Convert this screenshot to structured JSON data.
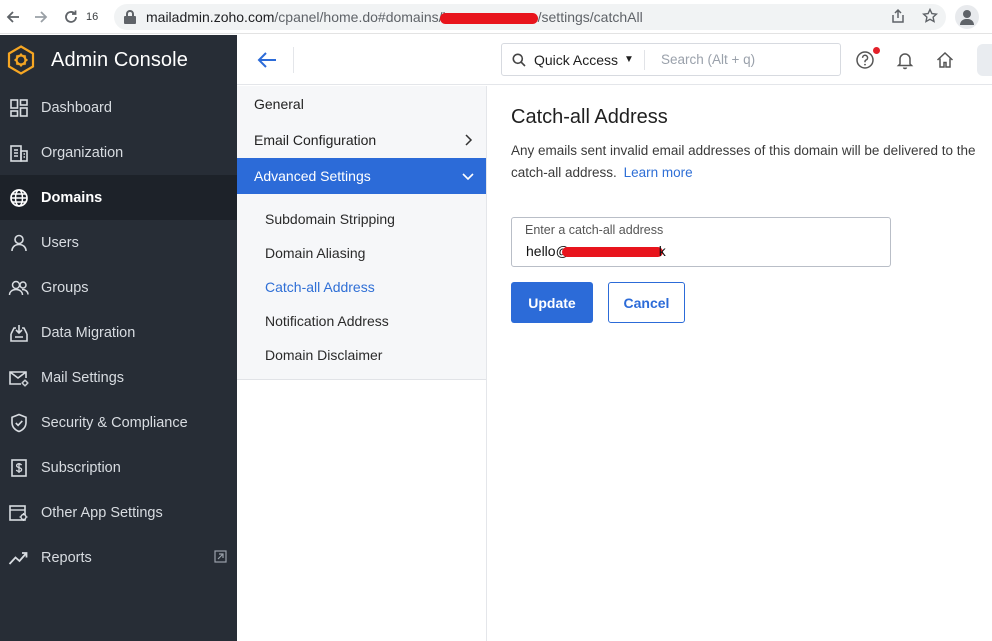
{
  "browser": {
    "tab_count": "16",
    "url_host": "mailadmin.zoho.com",
    "url_path_before": "/cpanel/home.do#domains/l",
    "url_path_after": "/settings/catchAll"
  },
  "sidebar": {
    "title": "Admin Console",
    "items": [
      {
        "label": "Dashboard",
        "icon": "dashboard-icon"
      },
      {
        "label": "Organization",
        "icon": "organization-icon"
      },
      {
        "label": "Domains",
        "icon": "globe-icon"
      },
      {
        "label": "Users",
        "icon": "user-icon"
      },
      {
        "label": "Groups",
        "icon": "groups-icon"
      },
      {
        "label": "Data Migration",
        "icon": "data-migration-icon"
      },
      {
        "label": "Mail Settings",
        "icon": "mail-settings-icon"
      },
      {
        "label": "Security & Compliance",
        "icon": "shield-icon"
      },
      {
        "label": "Subscription",
        "icon": "subscription-icon"
      },
      {
        "label": "Other App Settings",
        "icon": "app-settings-icon"
      },
      {
        "label": "Reports",
        "icon": "reports-icon"
      }
    ]
  },
  "header": {
    "quick_access": "Quick Access",
    "search_placeholder": "Search (Alt + q)"
  },
  "subnav": {
    "general": "General",
    "email_configuration": "Email Configuration",
    "advanced_settings": "Advanced Settings",
    "children": [
      "Subdomain Stripping",
      "Domain Aliasing",
      "Catch-all Address",
      "Notification Address",
      "Domain Disclaimer"
    ]
  },
  "main": {
    "title": "Catch-all Address",
    "description_line1": "Any emails sent invalid email addresses of this domain will be delivered to the",
    "description_line2": "catch-all address.",
    "learn_more": "Learn more",
    "field_label": "Enter a catch-all address",
    "field_value_prefix": "hello@",
    "field_value_suffix": "k",
    "update_label": "Update",
    "cancel_label": "Cancel"
  },
  "colors": {
    "sidebar_bg": "#272d36",
    "accent": "#2c6bd8",
    "redaction": "#e8141c"
  }
}
